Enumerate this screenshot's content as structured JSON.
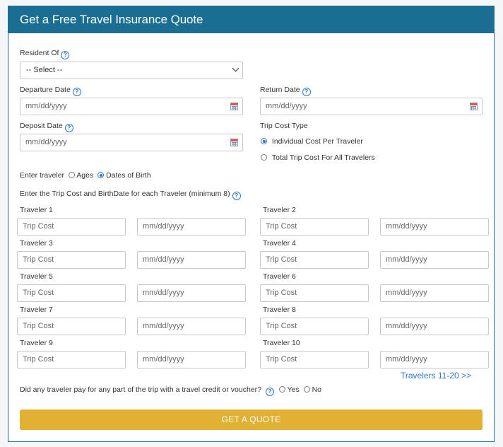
{
  "header": {
    "title": "Get a Free Travel Insurance Quote"
  },
  "resident": {
    "label": "Resident Of",
    "value": "-- Select --"
  },
  "departure": {
    "label": "Departure Date",
    "placeholder": "mm/dd/yyyy"
  },
  "return_date": {
    "label": "Return Date",
    "placeholder": "mm/dd/yyyy"
  },
  "deposit": {
    "label": "Deposit Date",
    "placeholder": "mm/dd/yyyy"
  },
  "trip_cost_type": {
    "label": "Trip Cost Type",
    "opt1": "Individual Cost Per Traveler",
    "opt2": "Total Trip Cost For All Travelers"
  },
  "enter_traveler": {
    "label": "Enter traveler",
    "opt_ages": "Ages",
    "opt_dob": "Dates of Birth"
  },
  "instruction": "Enter the Trip Cost and BirthDate for each Traveler (minimum 8)",
  "cost_placeholder": "Trip Cost",
  "dob_placeholder": "mm/dd/yyyy",
  "travelers": [
    "Traveler 1",
    "Traveler 2",
    "Traveler 3",
    "Traveler 4",
    "Traveler 5",
    "Traveler 6",
    "Traveler 7",
    "Traveler 8",
    "Traveler 9",
    "Traveler 10"
  ],
  "more_link": "Travelers 11-20 >>",
  "voucher": {
    "question": "Did any traveler pay for any part of the trip with a travel credit or voucher?",
    "yes": "Yes",
    "no": "No"
  },
  "submit": "GET A QUOTE",
  "colors": {
    "header": "#1a6d93",
    "button": "#e0b133",
    "link": "#2c76c9"
  }
}
